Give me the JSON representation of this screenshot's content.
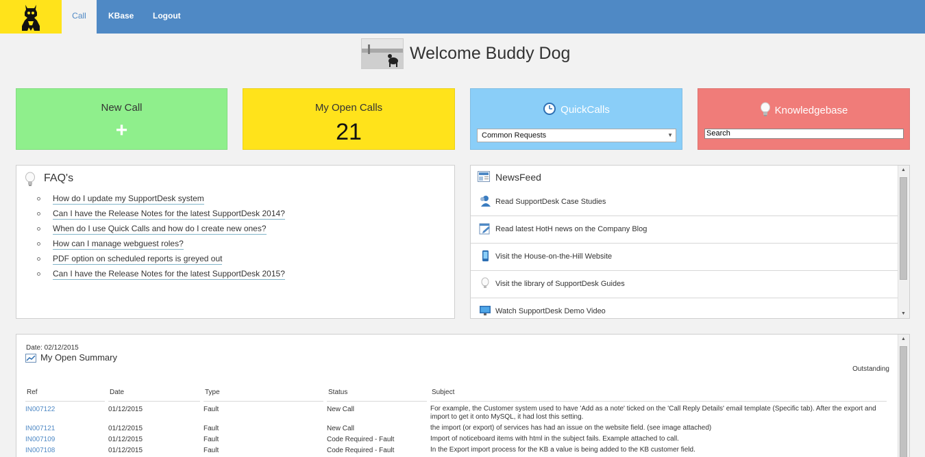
{
  "nav": {
    "items": [
      {
        "label": "Call"
      },
      {
        "label": "KBase"
      },
      {
        "label": "Logout"
      }
    ]
  },
  "welcome": {
    "text": "Welcome Buddy Dog"
  },
  "tiles": {
    "new_call": {
      "title": "New Call",
      "icon": "+"
    },
    "open_calls": {
      "title": "My Open Calls",
      "count": "21"
    },
    "quick_calls": {
      "title": "QuickCalls",
      "selected": "Common Requests"
    },
    "knowledgebase": {
      "title": "Knowledgebase",
      "search_value": "Search"
    }
  },
  "faq": {
    "title": "FAQ's",
    "items": [
      "How do I update my SupportDesk system",
      "Can I have the Release Notes for the latest SupportDesk 2014?",
      "When do I use Quick Calls and how do I create new ones?",
      "How can I manage webguest roles?",
      "PDF option on scheduled reports is greyed out",
      "Can I have the Release Notes for the latest SupportDesk 2015?"
    ]
  },
  "newsfeed": {
    "title": "NewsFeed",
    "items": [
      {
        "label": "Read SupportDesk Case Studies",
        "icon": "user-icon"
      },
      {
        "label": "Read latest HotH news on the Company Blog",
        "icon": "blog-icon"
      },
      {
        "label": "Visit the House-on-the-Hill Website",
        "icon": "phone-icon"
      },
      {
        "label": "Visit the library of SupportDesk Guides",
        "icon": "lightbulb-icon"
      },
      {
        "label": "Watch SupportDesk Demo Video",
        "icon": "monitor-icon"
      }
    ]
  },
  "summary": {
    "date": "Date: 02/12/2015",
    "title": "My Open Summary",
    "outstanding": "Outstanding",
    "columns": [
      "Ref",
      "Date",
      "Type",
      "Status",
      "Subject"
    ],
    "rows": [
      {
        "ref": "IN007122",
        "date": "01/12/2015",
        "type": "Fault",
        "status": "New Call",
        "subject": "For example, the Customer system used to have 'Add as a note' ticked on the 'Call Reply Details' email template (Specific tab). After the export and import to get it onto MySQL, it had lost this setting."
      },
      {
        "ref": "IN007121",
        "date": "01/12/2015",
        "type": "Fault",
        "status": "New Call",
        "subject": "the import (or export) of services has had an issue on the website field. (see image attached)"
      },
      {
        "ref": "IN007109",
        "date": "01/12/2015",
        "type": "Fault",
        "status": "Code Required - Fault",
        "subject": "Import of noticeboard items with html in the subject fails. Example attached to call."
      },
      {
        "ref": "IN007108",
        "date": "01/12/2015",
        "type": "Fault",
        "status": "Code Required - Fault",
        "subject": "In the Export import process for the KB a value is being added to the KB customer field."
      }
    ]
  }
}
